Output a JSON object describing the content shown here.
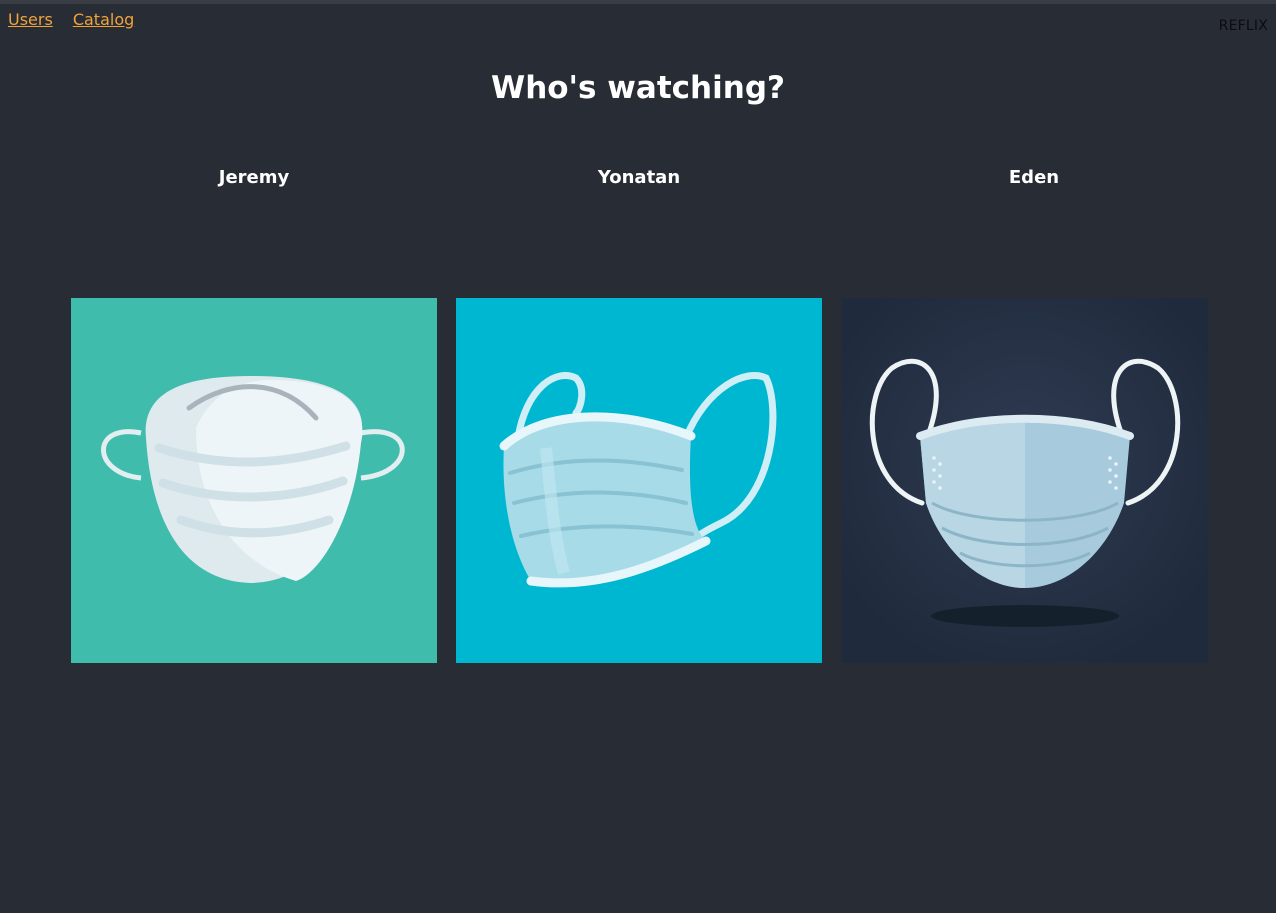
{
  "nav": {
    "links": [
      {
        "label": "Users"
      },
      {
        "label": "Catalog"
      }
    ]
  },
  "brand": "REFLIX",
  "heading": "Who's watching?",
  "users": [
    {
      "name": "Jeremy",
      "avatar_icon": "n95-mask-icon",
      "bg_color": "#40bcad"
    },
    {
      "name": "Yonatan",
      "avatar_icon": "surgical-mask-side-icon",
      "bg_color": "#00b7d2"
    },
    {
      "name": "Eden",
      "avatar_icon": "surgical-mask-front-icon",
      "bg_color": "#212c3e"
    }
  ],
  "colors": {
    "page_bg": "#282c34",
    "link": "#f0a33a",
    "text": "#ffffff"
  }
}
